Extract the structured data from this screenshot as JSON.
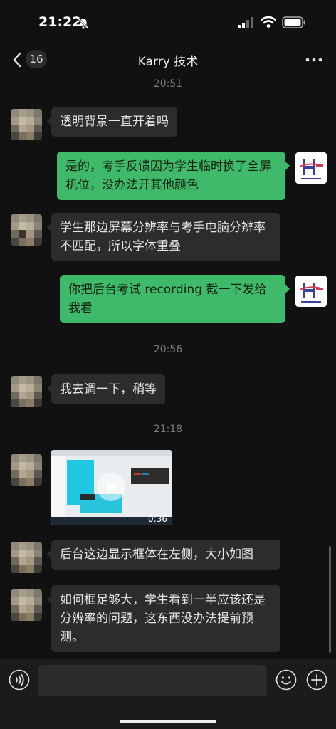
{
  "status_bar": {
    "time": "21:22"
  },
  "nav": {
    "back_badge": "16",
    "title": "Karry 技术"
  },
  "messages": [
    {
      "kind": "time",
      "text": "20:51"
    },
    {
      "kind": "in",
      "text": "透明背景一直开着吗"
    },
    {
      "kind": "out",
      "text": "是的，考手反馈因为学生临时换了全屏机位，没办法开其他颜色"
    },
    {
      "kind": "in",
      "text": "学生那边屏幕分辨率与考手电脑分辨率不匹配，所以字体重叠"
    },
    {
      "kind": "out",
      "text": "你把后台考试 recording 截一下发给我看"
    },
    {
      "kind": "time",
      "text": "20:56"
    },
    {
      "kind": "in",
      "text": "我去调一下，稍等"
    },
    {
      "kind": "time",
      "text": "21:18"
    },
    {
      "kind": "video",
      "duration": "0:36"
    },
    {
      "kind": "in",
      "text": "后台这边显示框体在左侧，大小如图"
    },
    {
      "kind": "in",
      "text": "如何框足够大，学生看到一半应该还是分辨率的问题，这东西没办法提前预测。"
    }
  ],
  "colors": {
    "bg": "#111111",
    "bubble_in": "#2c2c2c",
    "bubble_out": "#3fb96a",
    "accent": "#3fb96a"
  },
  "icons": [
    "bell-mute-icon",
    "signal-icon",
    "wifi-icon",
    "battery-icon",
    "back-icon",
    "more-icon",
    "voice-icon",
    "emoji-icon",
    "plus-icon",
    "play-icon"
  ]
}
